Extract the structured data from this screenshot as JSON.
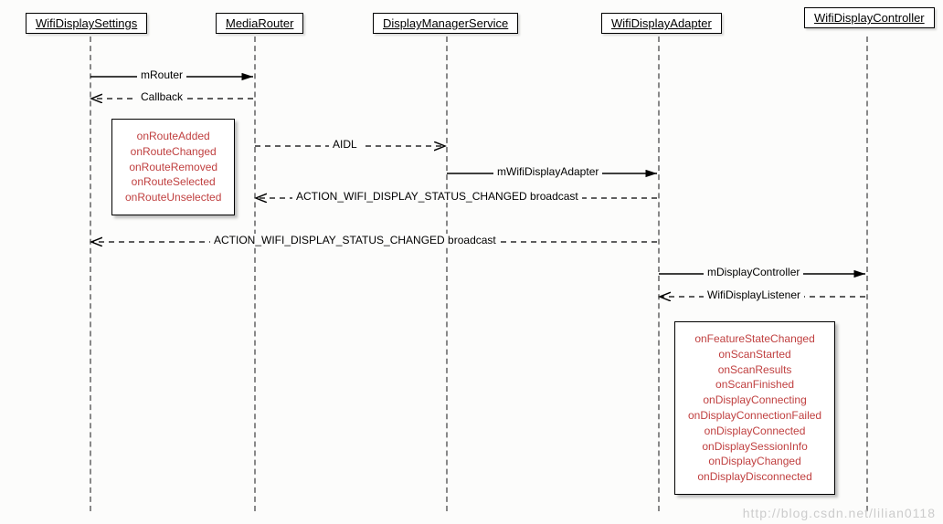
{
  "participants": {
    "p1": "WifiDisplaySettings",
    "p2": "MediaRouter",
    "p3": "DisplayManagerService",
    "p4": "WifiDisplayAdapter",
    "p5": "WifiDisplayController"
  },
  "messages": {
    "m1": "mRouter",
    "m2": "Callback",
    "m3": "AIDL",
    "m4": "mWifiDisplayAdapter",
    "m5": "ACTION_WIFI_DISPLAY_STATUS_CHANGED broadcast",
    "m6": "ACTION_WIFI_DISPLAY_STATUS_CHANGED broadcast",
    "m7": "mDisplayController",
    "m8": "WifiDisplayListener"
  },
  "note_left": {
    "l1": "onRouteAdded",
    "l2": "onRouteChanged",
    "l3": "onRouteRemoved",
    "l4": "onRouteSelected",
    "l5": "onRouteUnselected"
  },
  "note_right": {
    "l1": "onFeatureStateChanged",
    "l2": "onScanStarted",
    "l3": "onScanResults",
    "l4": "onScanFinished",
    "l5": "onDisplayConnecting",
    "l6": "onDisplayConnectionFailed",
    "l7": "onDisplayConnected",
    "l8": "onDisplaySessionInfo",
    "l9": "onDisplayChanged",
    "l10": "onDisplayDisconnected"
  },
  "watermark": "http://blog.csdn.net/lilian0118",
  "chart_data": {
    "type": "sequence_diagram",
    "participants": [
      "WifiDisplaySettings",
      "MediaRouter",
      "DisplayManagerService",
      "WifiDisplayAdapter",
      "WifiDisplayController"
    ],
    "messages": [
      {
        "from": "WifiDisplaySettings",
        "to": "MediaRouter",
        "label": "mRouter",
        "style": "solid"
      },
      {
        "from": "MediaRouter",
        "to": "WifiDisplaySettings",
        "label": "Callback",
        "style": "dashed"
      },
      {
        "from": "MediaRouter",
        "to": "DisplayManagerService",
        "label": "AIDL",
        "style": "dashed"
      },
      {
        "from": "DisplayManagerService",
        "to": "WifiDisplayAdapter",
        "label": "mWifiDisplayAdapter",
        "style": "solid"
      },
      {
        "from": "WifiDisplayAdapter",
        "to": "MediaRouter",
        "label": "ACTION_WIFI_DISPLAY_STATUS_CHANGED broadcast",
        "style": "dashed"
      },
      {
        "from": "WifiDisplayAdapter",
        "to": "WifiDisplaySettings",
        "label": "ACTION_WIFI_DISPLAY_STATUS_CHANGED broadcast",
        "style": "dashed"
      },
      {
        "from": "WifiDisplayAdapter",
        "to": "WifiDisplayController",
        "label": "mDisplayController",
        "style": "solid"
      },
      {
        "from": "WifiDisplayController",
        "to": "WifiDisplayAdapter",
        "label": "WifiDisplayListener",
        "style": "dashed"
      }
    ],
    "notes": [
      {
        "attached_to": "MediaRouter-callback",
        "lines": [
          "onRouteAdded",
          "onRouteChanged",
          "onRouteRemoved",
          "onRouteSelected",
          "onRouteUnselected"
        ]
      },
      {
        "attached_to": "WifiDisplayListener",
        "lines": [
          "onFeatureStateChanged",
          "onScanStarted",
          "onScanResults",
          "onScanFinished",
          "onDisplayConnecting",
          "onDisplayConnectionFailed",
          "onDisplayConnected",
          "onDisplaySessionInfo",
          "onDisplayChanged",
          "onDisplayDisconnected"
        ]
      }
    ]
  }
}
